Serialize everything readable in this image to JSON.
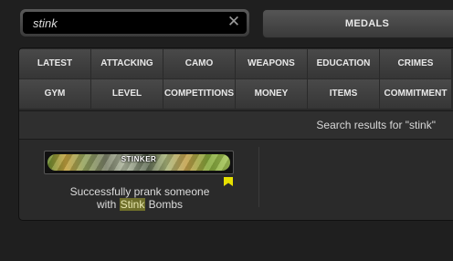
{
  "search": {
    "value": "stink",
    "clear_icon": "close-icon"
  },
  "medals_tab": {
    "label": "MEDALS"
  },
  "categories_row1": [
    "LATEST",
    "ATTACKING",
    "CAMO",
    "WEAPONS",
    "EDUCATION",
    "CRIMES"
  ],
  "categories_row2": [
    "GYM",
    "LEVEL",
    "COMPETITIONS",
    "MONEY",
    "ITEMS",
    "COMMITMENT"
  ],
  "results": {
    "text": "Search results for \"stink\""
  },
  "medal": {
    "name": "STINKER",
    "desc_line1": "Successfully prank someone",
    "desc_line2_pre": "with ",
    "desc_highlight": "Stink",
    "desc_line2_post": " Bombs",
    "flag_color": "#e6e000"
  }
}
